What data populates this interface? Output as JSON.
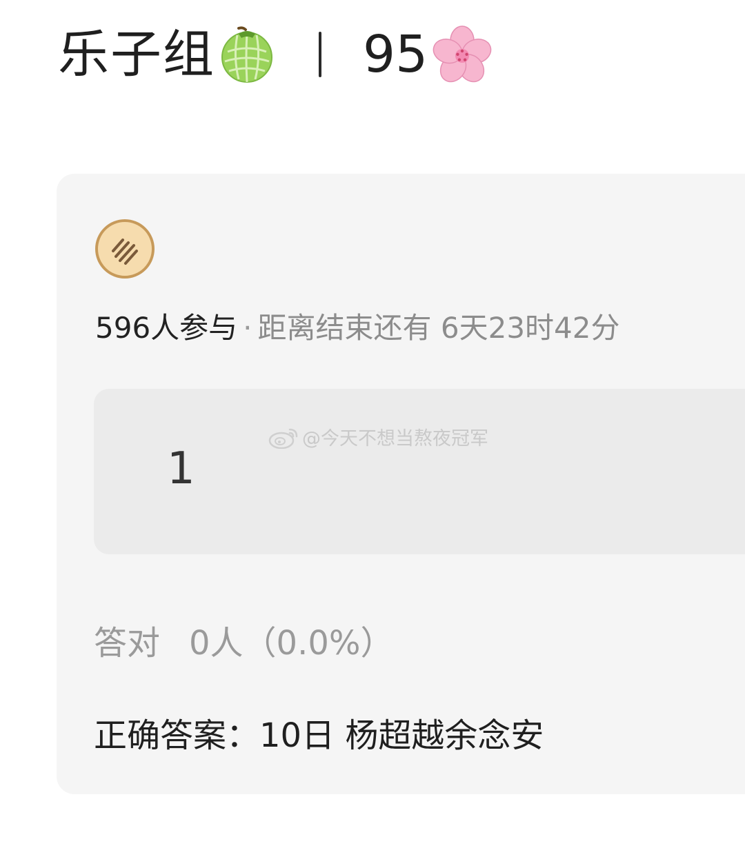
{
  "header": {
    "group_name": "乐子组",
    "melon_icon": "melon-icon",
    "score": "95",
    "blossom_icon": "cherry-blossom-icon"
  },
  "card": {
    "avatar_icon": "cookie-avatar-icon",
    "participants": "596人参与",
    "separator": "·",
    "countdown": "距离结束还有 6天23时42分",
    "answer_value": "1",
    "watermark": "@今天不想当熬夜冠军",
    "correct_label": "答对",
    "correct_count": "0人（0.0%）",
    "correct_answer": "正确答案：10日 杨超越余念安"
  },
  "colors": {
    "card_bg": "#f5f5f5",
    "answer_box_bg": "#ebebeb",
    "text_primary": "#1f1f1f",
    "text_secondary": "#9a9a9a",
    "melon_green": "#8fcf4f",
    "blossom_pink": "#f7b6cf"
  }
}
